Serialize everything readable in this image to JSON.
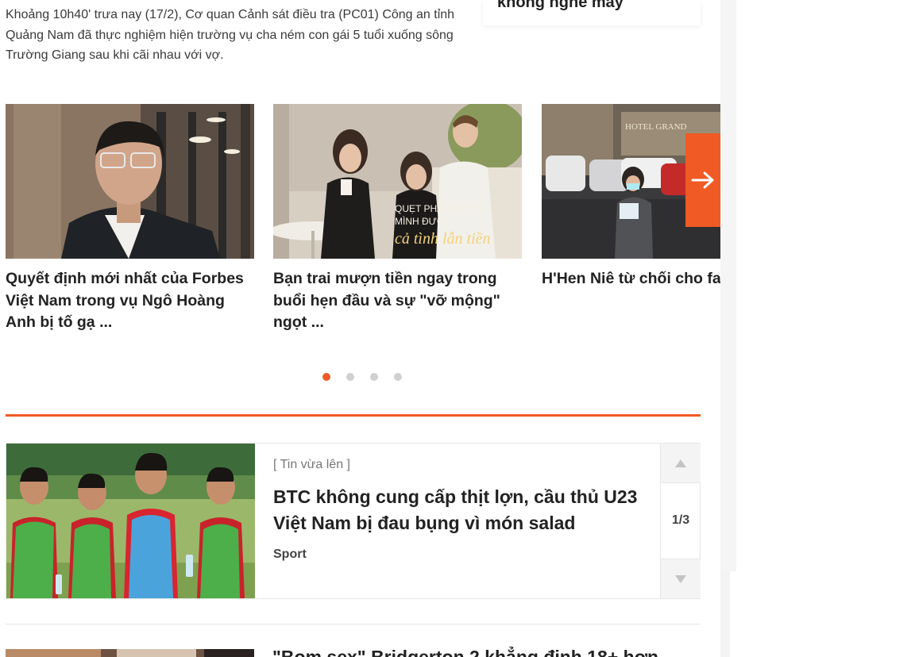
{
  "lead_text": "Khoảng 10h40' trưa nay (17/2), Cơ quan Cảnh sát điều tra (PC01) Công an tỉnh Quảng Nam đã thực nghiệm hiện trường vụ cha ném con gái 5 tuổi xuống sông Trường Giang sau khi cãi nhau với vợ.",
  "side_card": {
    "title": "không nghe máy"
  },
  "carousel": {
    "slides": [
      {
        "headline": "Quyết định mới nhất của Forbes Việt Nam trong vụ Ngô Hoàng Anh bị tố gạ ..."
      },
      {
        "headline": "Bạn trai mượn tiền ngay trong buổi hẹn đầu và sự \"vỡ mộng\" ngọt ...",
        "overlay_line1": "QUẸT PHẢI MỘT CÁI",
        "overlay_line2": "MÌNH ĐƯỢC",
        "overlay_script": "cả tình lẫn tiền"
      },
      {
        "headline": "H'Hen Niê từ chối cho fa chữ ký, nguyên nhân ph khiến dân tình gật gù?",
        "sign_text": "HOTEL GRAND"
      }
    ],
    "next_icon": "arrow-right-icon",
    "dots_total": 4,
    "dots_active": 1
  },
  "ticker": {
    "tag": "[ Tin vừa lên ]",
    "title": "BTC không cung cấp thịt lợn, cầu thủ U23 Việt Nam bị đau bụng vì món salad",
    "category": "Sport",
    "counter": "1/3",
    "up_icon": "triangle-up-icon",
    "down_icon": "triangle-down-icon"
  },
  "next_article": {
    "title": "\"Bom sex\" Bridgerton 2 khẳng định 18+ hơn"
  },
  "colors": {
    "accent": "#f05a24",
    "text": "#222222",
    "muted": "#777777"
  }
}
